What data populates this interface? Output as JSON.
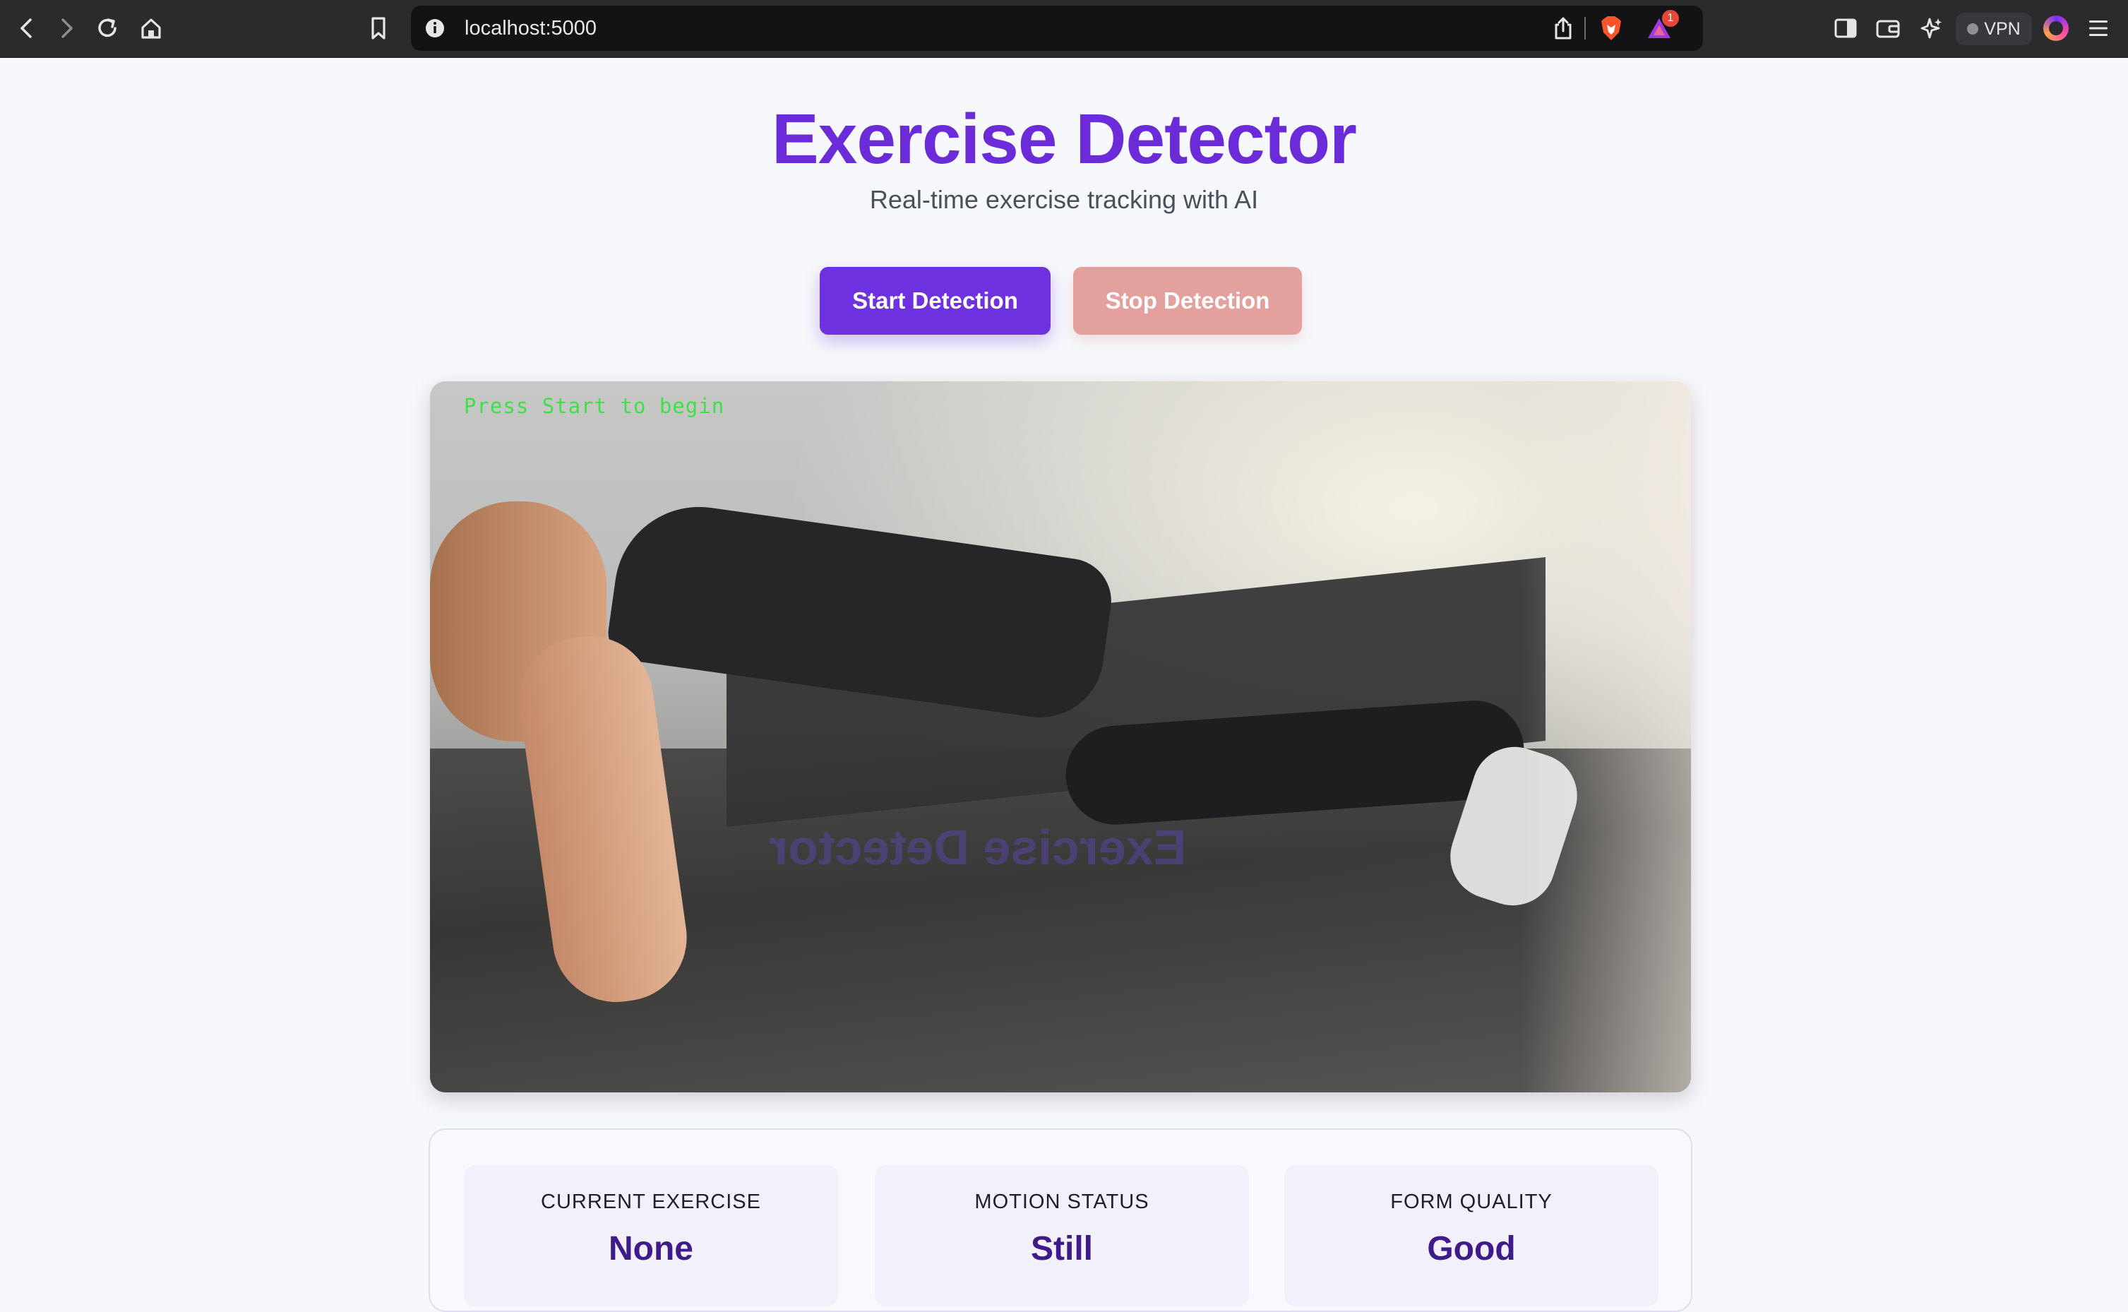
{
  "browser": {
    "url": "localhost:5000",
    "notification_count": "1",
    "vpn_label": "VPN"
  },
  "header": {
    "title": "Exercise Detector",
    "subtitle": "Real-time exercise tracking with AI"
  },
  "controls": {
    "start_label": "Start Detection",
    "stop_label": "Stop Detection"
  },
  "video": {
    "overlay_text": "Press Start to begin",
    "reflection_text": "Exercise Detector"
  },
  "stats": [
    {
      "label": "CURRENT EXERCISE",
      "value": "None"
    },
    {
      "label": "MOTION STATUS",
      "value": "Still"
    },
    {
      "label": "FORM QUALITY",
      "value": "Good"
    }
  ],
  "colors": {
    "accent": "#6e31e0",
    "title": "#6c2bd9",
    "stop_button": "#e3a09c",
    "overlay_text": "#3ee04a",
    "stat_value": "#3e1a8a"
  }
}
